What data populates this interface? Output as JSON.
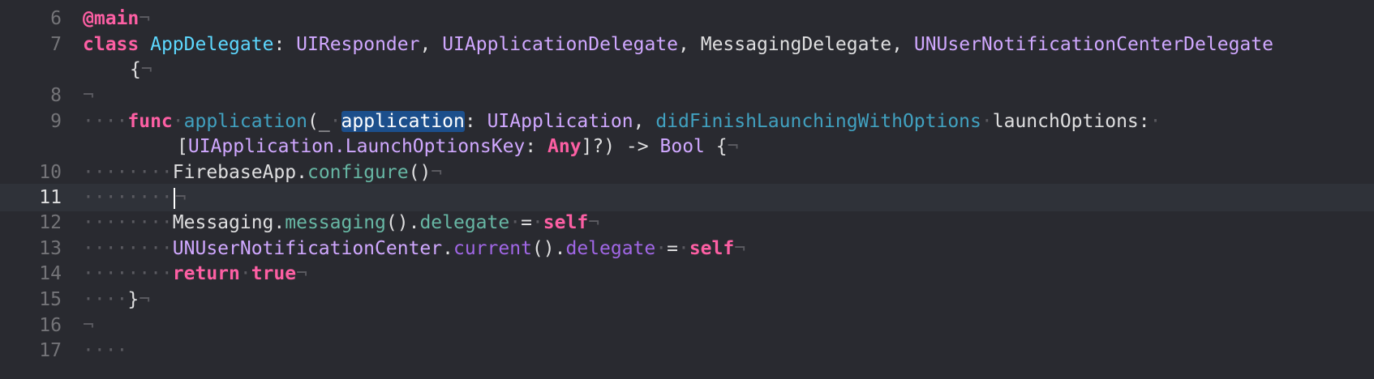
{
  "editor": {
    "active_line": "11",
    "line_numbers": [
      "6",
      "7",
      "8",
      "9",
      "10",
      "11",
      "12",
      "13",
      "14",
      "15",
      "16",
      "17"
    ],
    "code": {
      "l6_attr": "@main",
      "l7_class_kw": "class",
      "l7_class_name": "AppDelegate",
      "l7_colon": ":",
      "l7_t1": "UIResponder",
      "l7_c1": ",",
      "l7_t2": "UIApplicationDelegate",
      "l7_c2": ",",
      "l7_t3": "MessagingDelegate",
      "l7_c3": ",",
      "l7_t4": "UNUserNotificationCenterDelegate",
      "l7_brace": "{",
      "l9_func_kw": "func",
      "l9_func_name": "application",
      "l9_paren": "(_",
      "l9_param_selected": "application",
      "l9_colon": ":",
      "l9_type1": "UIApplication",
      "l9_comma": ",",
      "l9_label": "didFinishLaunchingWithOptions",
      "l9_param2": "launchOptions:",
      "l9b_open": "[",
      "l9b_type2": "UIApplication.LaunchOptionsKey",
      "l9b_colon": ":",
      "l9b_any": "Any",
      "l9b_rest": "]?) ->",
      "l9b_bool": "Bool",
      "l9b_brace": "{",
      "l10_obj": "FirebaseApp",
      "l10_dot": ".",
      "l10_method": "configure",
      "l10_call": "()",
      "l12_obj": "Messaging",
      "l12_dot": ".",
      "l12_method": "messaging",
      "l12_call": "().",
      "l12_prop": "delegate",
      "l12_eq": "=",
      "l12_self": "self",
      "l13_obj": "UNUserNotificationCenter",
      "l13_dot": ".",
      "l13_method": "current",
      "l13_call": "().",
      "l13_prop": "delegate",
      "l13_eq": "=",
      "l13_self": "self",
      "l14_return": "return",
      "l14_true": "true",
      "l15_brace": "}"
    },
    "invisibles": {
      "newline": "¬",
      "space": "·",
      "indent4": "····",
      "indent8": "········"
    },
    "colors": {
      "background": "#292a30",
      "keyword": "#fc5fa3",
      "declaration": "#5dd8ff",
      "type": "#d0a8ff",
      "method": "#67b7a4",
      "other_method": "#a167e6",
      "selection": "#1c4f8c"
    }
  }
}
